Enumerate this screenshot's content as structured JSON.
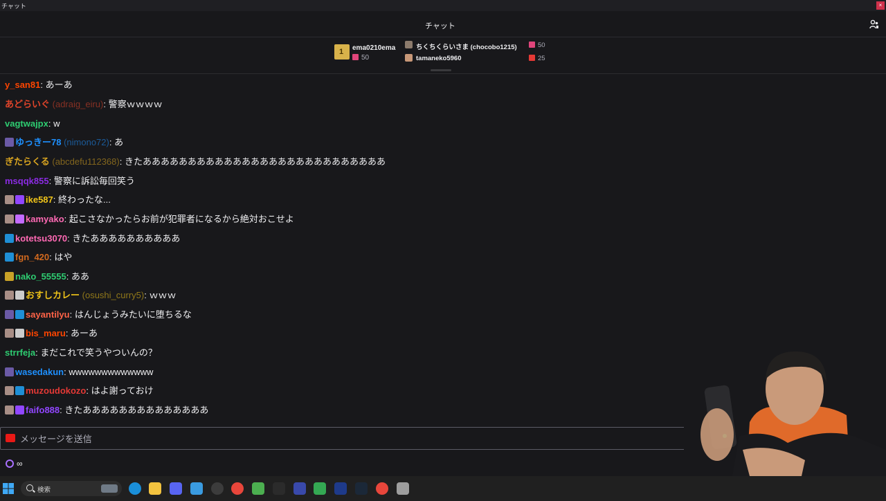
{
  "window": {
    "title": "チャット",
    "close_label": "×"
  },
  "header": {
    "title": "チャット",
    "users_icon": "users-icon"
  },
  "gifts": {
    "top": {
      "name": "ema0210ema",
      "count": "50"
    },
    "leaders": [
      {
        "name": "ちくちくらいさま (chocobo1215)",
        "count": "50"
      },
      {
        "name": "tamaneko5960",
        "count": "25"
      }
    ]
  },
  "messages": [
    {
      "user": "y_san81",
      "login": "",
      "color": "#ff4500",
      "badges": [],
      "text": "あーあ"
    },
    {
      "user": "あどらいぐ",
      "login": "(adraig_eiru)",
      "color": "#e0442a",
      "badges": [],
      "text": "警察ｗｗｗｗ"
    },
    {
      "user": "vagtwajpx",
      "login": "",
      "color": "#2ecc71",
      "badges": [],
      "text": "w"
    },
    {
      "user": "ゆっきー78",
      "login": "(nimono72)",
      "color": "#1e90ff",
      "badges": [
        "#6b5aa6"
      ],
      "text": "あ"
    },
    {
      "user": "ぎたらくる",
      "login": "(abcdefu112368)",
      "color": "#daa520",
      "badges": [],
      "text": "きたあああああああああああああああああああああああああああ"
    },
    {
      "user": "msqqk855",
      "login": "",
      "color": "#8a2be2",
      "badges": [],
      "text": "警察に訴訟毎回笑う"
    },
    {
      "user": "ike587",
      "login": "",
      "color": "#f0c419",
      "badges": [
        "#a88e86",
        "#9146ff"
      ],
      "text": "終わったな..."
    },
    {
      "user": "kamyako",
      "login": "",
      "color": "#ff69b4",
      "badges": [
        "#a88e86",
        "#c36bff"
      ],
      "text": "起こさなかったらお前が犯罪者になるから絶対おこせよ"
    },
    {
      "user": "kotetsu3070",
      "login": "",
      "color": "#ff69b4",
      "badges": [
        "#1f8fd6"
      ],
      "text": "きたああああああああああ"
    },
    {
      "user": "fgn_420",
      "login": "",
      "color": "#d2691e",
      "badges": [
        "#1f8fd6"
      ],
      "text": "はや"
    },
    {
      "user": "nako_55555",
      "login": "",
      "color": "#2ecc71",
      "badges": [
        "#c9a227"
      ],
      "text": "ああ"
    },
    {
      "user": "おすしカレー",
      "login": "(osushi_curry5)",
      "color": "#f0c419",
      "badges": [
        "#a88e86",
        "#cccccc"
      ],
      "text": "ｗｗｗ"
    },
    {
      "user": "sayantilyu",
      "login": "",
      "color": "#ff6347",
      "badges": [
        "#6b5aa6",
        "#1f8fd6"
      ],
      "text": "はんじょうみたいに堕ちるな"
    },
    {
      "user": "bis_maru",
      "login": "",
      "color": "#ff4500",
      "badges": [
        "#a88e86",
        "#cccccc"
      ],
      "text": "あーあ"
    },
    {
      "user": "strrfeja",
      "login": "",
      "color": "#2ecc71",
      "badges": [],
      "text": "まだこれで笑うやついんの？"
    },
    {
      "user": "wasedakun",
      "login": "",
      "color": "#1e90ff",
      "badges": [
        "#6b5aa6"
      ],
      "text": "wwwwwwwwwwwww"
    },
    {
      "user": "muzoudokozo",
      "login": "",
      "color": "#e53935",
      "badges": [
        "#a88e86",
        "#1f8fd6"
      ],
      "text": "はよ謝っておけ"
    },
    {
      "user": "faifo888",
      "login": "",
      "color": "#9146ff",
      "badges": [
        "#a88e86",
        "#9146ff"
      ],
      "text": "きたああああああああああああああ"
    }
  ],
  "input": {
    "placeholder": "メッセージを送信"
  },
  "points": {
    "value": "∞"
  },
  "taskbar": {
    "search_label": "検索",
    "apps": [
      {
        "name": "edge-icon",
        "color": "#1a8fd9"
      },
      {
        "name": "folder-icon",
        "color": "#f3c33f"
      },
      {
        "name": "discord-icon",
        "color": "#5865f2"
      },
      {
        "name": "notepad-icon",
        "color": "#3a9be0"
      },
      {
        "name": "obs-icon",
        "color": "#3c3c3c"
      },
      {
        "name": "chrome-icon",
        "color": "#e8463b"
      },
      {
        "name": "minecraft-icon",
        "color": "#4caf50"
      },
      {
        "name": "x-icon",
        "color": "#2b2b2b"
      },
      {
        "name": "app-blue-icon",
        "color": "#3949ab"
      },
      {
        "name": "drive-icon",
        "color": "#34a853"
      },
      {
        "name": "monitor-icon",
        "color": "#1e3a8a"
      },
      {
        "name": "steam-icon",
        "color": "#1b2838"
      },
      {
        "name": "chrome-2-icon",
        "color": "#e8463b"
      },
      {
        "name": "tool-icon",
        "color": "#9e9e9e"
      }
    ]
  }
}
